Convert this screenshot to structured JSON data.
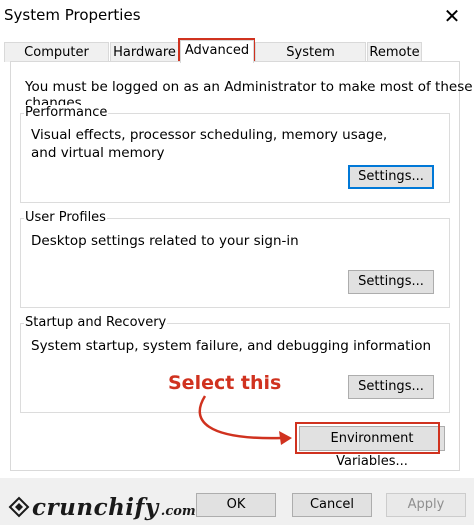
{
  "window": {
    "title": "System Properties"
  },
  "tabs": [
    {
      "label": "Computer Name"
    },
    {
      "label": "Hardware"
    },
    {
      "label": "Advanced"
    },
    {
      "label": "System Protection"
    },
    {
      "label": "Remote"
    }
  ],
  "active_tab": "Advanced",
  "notice": "You must be logged on as an Administrator to make most of these changes.",
  "groups": {
    "performance": {
      "label": "Performance",
      "description": "Visual effects, processor scheduling, memory usage, and virtual memory",
      "button": "Settings..."
    },
    "user_profiles": {
      "label": "User Profiles",
      "description": "Desktop settings related to your sign-in",
      "button": "Settings..."
    },
    "startup": {
      "label": "Startup and Recovery",
      "description": "System startup, system failure, and debugging information",
      "button": "Settings..."
    }
  },
  "env_button": "Environment Variables...",
  "callout": "Select this",
  "footer": {
    "ok": "OK",
    "cancel": "Cancel",
    "apply": "Apply"
  },
  "logo": {
    "text": "crunchify",
    "suffix": ".com"
  },
  "colors": {
    "highlight": "#d0321f",
    "focus": "#0078d7"
  }
}
